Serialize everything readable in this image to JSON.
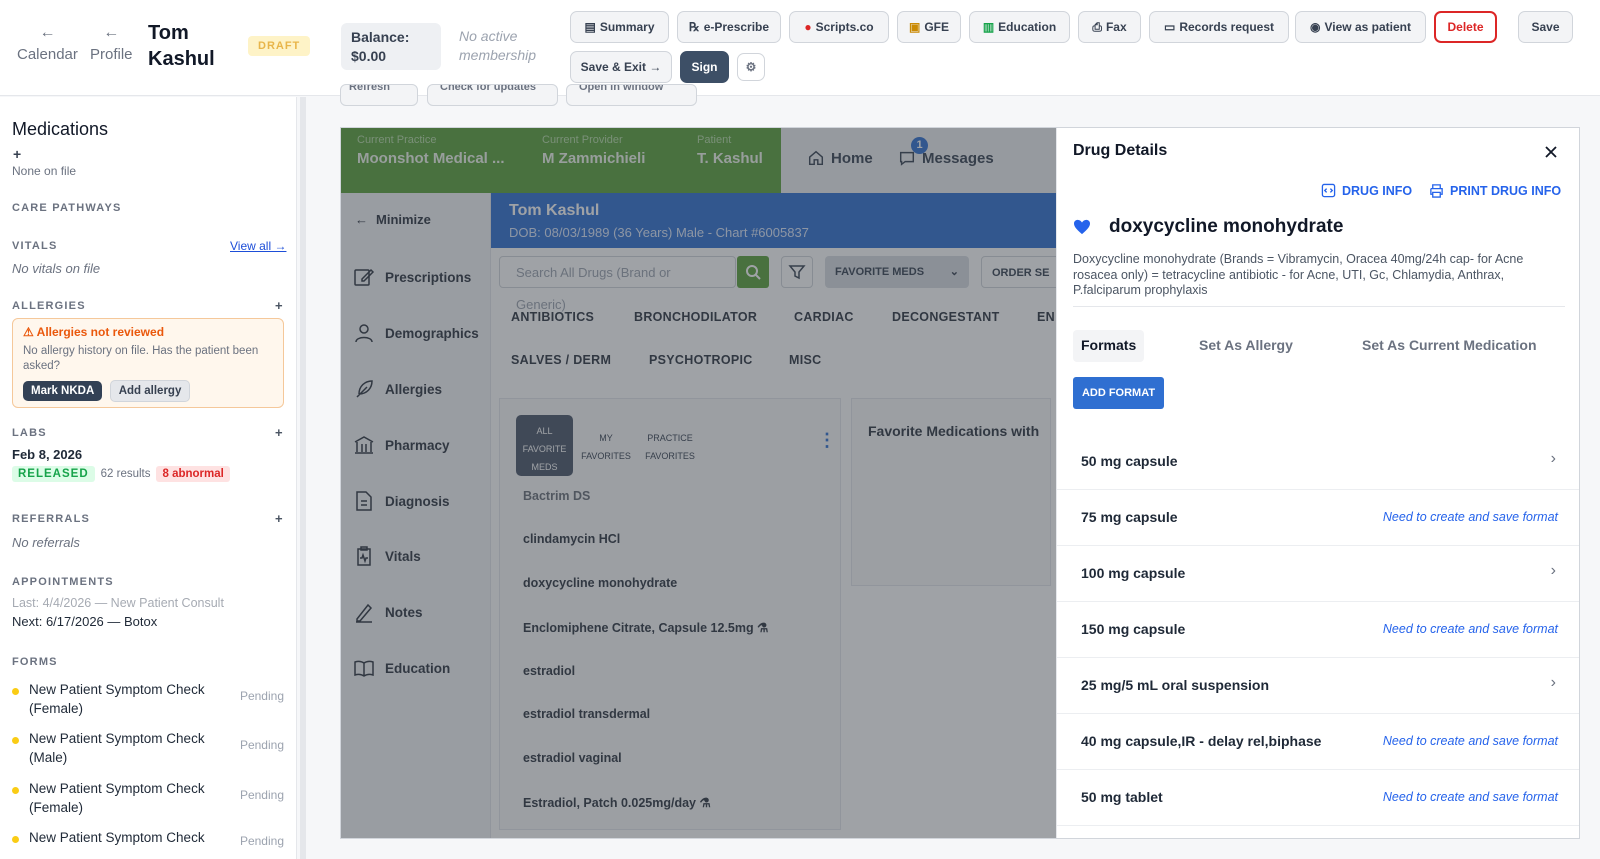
{
  "header": {
    "nav": [
      {
        "label": "Calendar"
      },
      {
        "label": "Profile"
      }
    ],
    "patient_first": "Tom",
    "patient_last": "Kashul",
    "status_badge": "DRAFT",
    "balance_label": "Balance:",
    "balance_value": "$0.00",
    "membership_line1": "No active",
    "membership_line2": "membership",
    "buttons": {
      "summary": "Summary",
      "eprescribe": "e-Prescribe",
      "scripts": "Scripts.co",
      "gfe": "GFE",
      "education": "Education",
      "fax": "Fax",
      "records": "Records request",
      "view_as_patient": "View as patient",
      "delete": "Delete",
      "save": "Save",
      "save_exit": "Save & Exit →",
      "sign": "Sign"
    }
  },
  "sidebar": {
    "medications_title": "Medications",
    "medications_add": "+",
    "medications_empty": "None on file",
    "care_pathways": "CARE PATHWAYS",
    "vitals": "VITALS",
    "vitals_link": "View all →",
    "vitals_empty": "No vitals on file",
    "allergies": "ALLERGIES",
    "allergy_alert_title": "⚠ Allergies not reviewed",
    "allergy_alert_body": "No allergy history on file. Has the patient been asked?",
    "mark_nkda": "Mark NKDA",
    "add_allergy": "Add allergy",
    "labs": "LABS",
    "labs_date": "Feb 8, 2026",
    "labs_released": "RELEASED",
    "labs_results": "62 results",
    "labs_abnormal": "8 abnormal",
    "referrals": "REFERRALS",
    "referrals_empty": "No referrals",
    "appointments": "APPOINTMENTS",
    "appt_last": "Last: 4/4/2026 — New Patient Consult",
    "appt_next": "Next: 6/17/2026 — Botox",
    "forms": "FORMS",
    "form_items": [
      {
        "name": "New Patient Symptom Check (Female)",
        "status": "Pending"
      },
      {
        "name": "New Patient Symptom Check (Male)",
        "status": "Pending"
      },
      {
        "name": "New Patient Symptom Check (Female)",
        "status": "Pending"
      },
      {
        "name": "New Patient Symptom Check",
        "status": "Pending"
      }
    ]
  },
  "toolbar_hidden": [
    "Refresh",
    "Check for updates",
    "Open in window"
  ],
  "app": {
    "current_practice_label": "Current Practice",
    "current_practice": "Moonshot Medical ...",
    "current_provider_label": "Current Provider",
    "current_provider": "M Zammichieli",
    "patient_label": "Patient",
    "patient_short": "T. Kashul",
    "home": "Home",
    "messages": "Messages",
    "messages_count": "1",
    "minimize": "Minimize",
    "patient_name": "Tom Kashul",
    "patient_details": "DOB: 08/03/1989 (36 Years) Male - Chart #6005837",
    "nav": [
      {
        "label": "Prescriptions"
      },
      {
        "label": "Demographics"
      },
      {
        "label": "Allergies"
      },
      {
        "label": "Pharmacy"
      },
      {
        "label": "Diagnosis"
      },
      {
        "label": "Vitals"
      },
      {
        "label": "Notes"
      },
      {
        "label": "Education"
      }
    ],
    "search_placeholder": "Search All Drugs (Brand or Generic)",
    "favorite_meds": "FAVORITE MEDS",
    "order_sets": "ORDER SE",
    "categories_row1": [
      "ANTIBIOTICS",
      "BRONCHODILATOR",
      "CARDIAC",
      "DECONGESTANT",
      "EN"
    ],
    "categories_row2": [
      "SALVES / DERM",
      "PSYCHOTROPIC",
      "MISC"
    ],
    "fav_tabs": {
      "all": "ALL FAVORITE MEDS",
      "my": "MY FAVORITES",
      "practice": "PRACTICE FAVORITES"
    },
    "favorites_heading": "Favorite Medications with",
    "meds": [
      {
        "name": "Bactrim DS"
      },
      {
        "name": "clindamycin HCl"
      },
      {
        "name": "doxycycline monohydrate"
      },
      {
        "name": "Enclomiphene Citrate, Capsule 12.5mg"
      },
      {
        "name": "estradiol"
      },
      {
        "name": "estradiol transdermal"
      },
      {
        "name": "estradiol vaginal"
      },
      {
        "name": "Estradiol, Patch 0.025mg/day"
      }
    ]
  },
  "drug_panel": {
    "title": "Drug Details",
    "drug_info": "DRUG INFO",
    "print_drug_info": "PRINT DRUG INFO",
    "drug_name": "doxycycline monohydrate",
    "description": "Doxycycline monohydrate (Brands = Vibramycin, Oracea 40mg/24h cap- for Acne rosacea only) = tetracycline antibiotic - for Acne, UTI, Gc, Chlamydia, Anthrax, P.falciparum prophylaxis",
    "tabs": [
      "Formats",
      "Set As Allergy",
      "Set As Current Medication"
    ],
    "add_format": "ADD FORMAT",
    "formats": [
      {
        "name": "50 mg capsule",
        "note": ""
      },
      {
        "name": "75 mg capsule",
        "note": "Need to create and save format"
      },
      {
        "name": "100 mg capsule",
        "note": ""
      },
      {
        "name": "150 mg capsule",
        "note": "Need to create and save format"
      },
      {
        "name": "25 mg/5 mL oral suspension",
        "note": ""
      },
      {
        "name": "40 mg capsule,IR - delay rel,biphase",
        "note": "Need to create and save format"
      },
      {
        "name": "50 mg tablet",
        "note": "Need to create and save format"
      }
    ]
  },
  "colors": {
    "brand_green": "#5aa13a",
    "patient_blue": "#2f6fd1",
    "sign_navy": "#3d4f66",
    "link_blue": "#2563eb",
    "danger": "#dc2626",
    "nkda_navy": "#334155"
  }
}
